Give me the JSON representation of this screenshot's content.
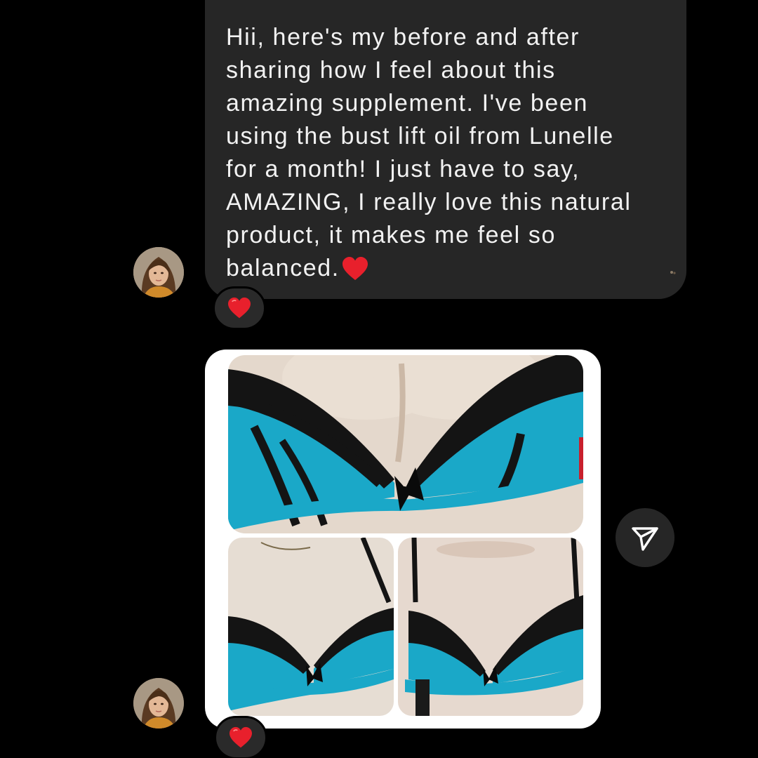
{
  "conversation": {
    "incoming_message": {
      "text": "Hii, here's my before and after\nsharing how I feel about this\namazing supplement. I've been\nusing the bust lift oil from Lunelle\nfor a month! I just have to say,\nAMAZING, I really love this natural\nproduct, it makes me feel so\nbalanced.",
      "trailing_emoji": "red-heart-icon",
      "reaction_emoji": "red-heart-icon",
      "sender_avatar": "avatar"
    },
    "image_message": {
      "image": "before-and-after-photo-collage",
      "panels": 3,
      "reaction_emoji": "red-heart-icon",
      "sender_avatar": "avatar"
    },
    "share_button": {
      "icon": "send-arrow-icon"
    }
  },
  "colors": {
    "background": "#000000",
    "bubble": "#262626",
    "text": "#f2f2f2",
    "heart": "#e8202c",
    "bra_turquoise": "#1aa8c8",
    "bra_black": "#141414"
  }
}
